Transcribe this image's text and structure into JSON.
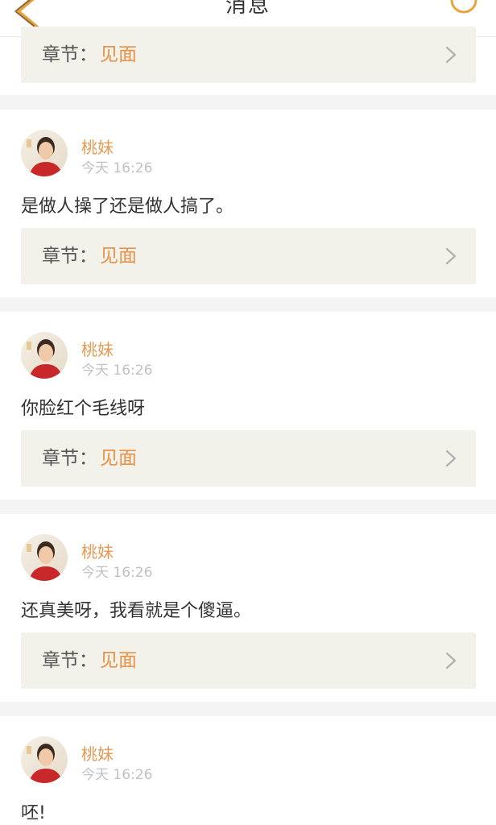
{
  "header": {
    "title": "消息",
    "back_icon": "chevron-left-icon",
    "search_icon": "search-icon",
    "accent_color": "#e8a33c"
  },
  "chapter_label": "章节：",
  "messages": [
    {
      "chapter": "见面"
    },
    {
      "username": "桃妹",
      "time": "今天 16:26",
      "text": "是做人操了还是做人搞了。",
      "chapter": "见面"
    },
    {
      "username": "桃妹",
      "time": "今天 16:26",
      "text": "你脸红个毛线呀",
      "chapter": "见面"
    },
    {
      "username": "桃妹",
      "time": "今天 16:26",
      "text": "还真美呀，我看就是个傻逼。",
      "chapter": "见面"
    },
    {
      "username": "桃妹",
      "time": "今天 16:26",
      "text": "呸!"
    }
  ]
}
